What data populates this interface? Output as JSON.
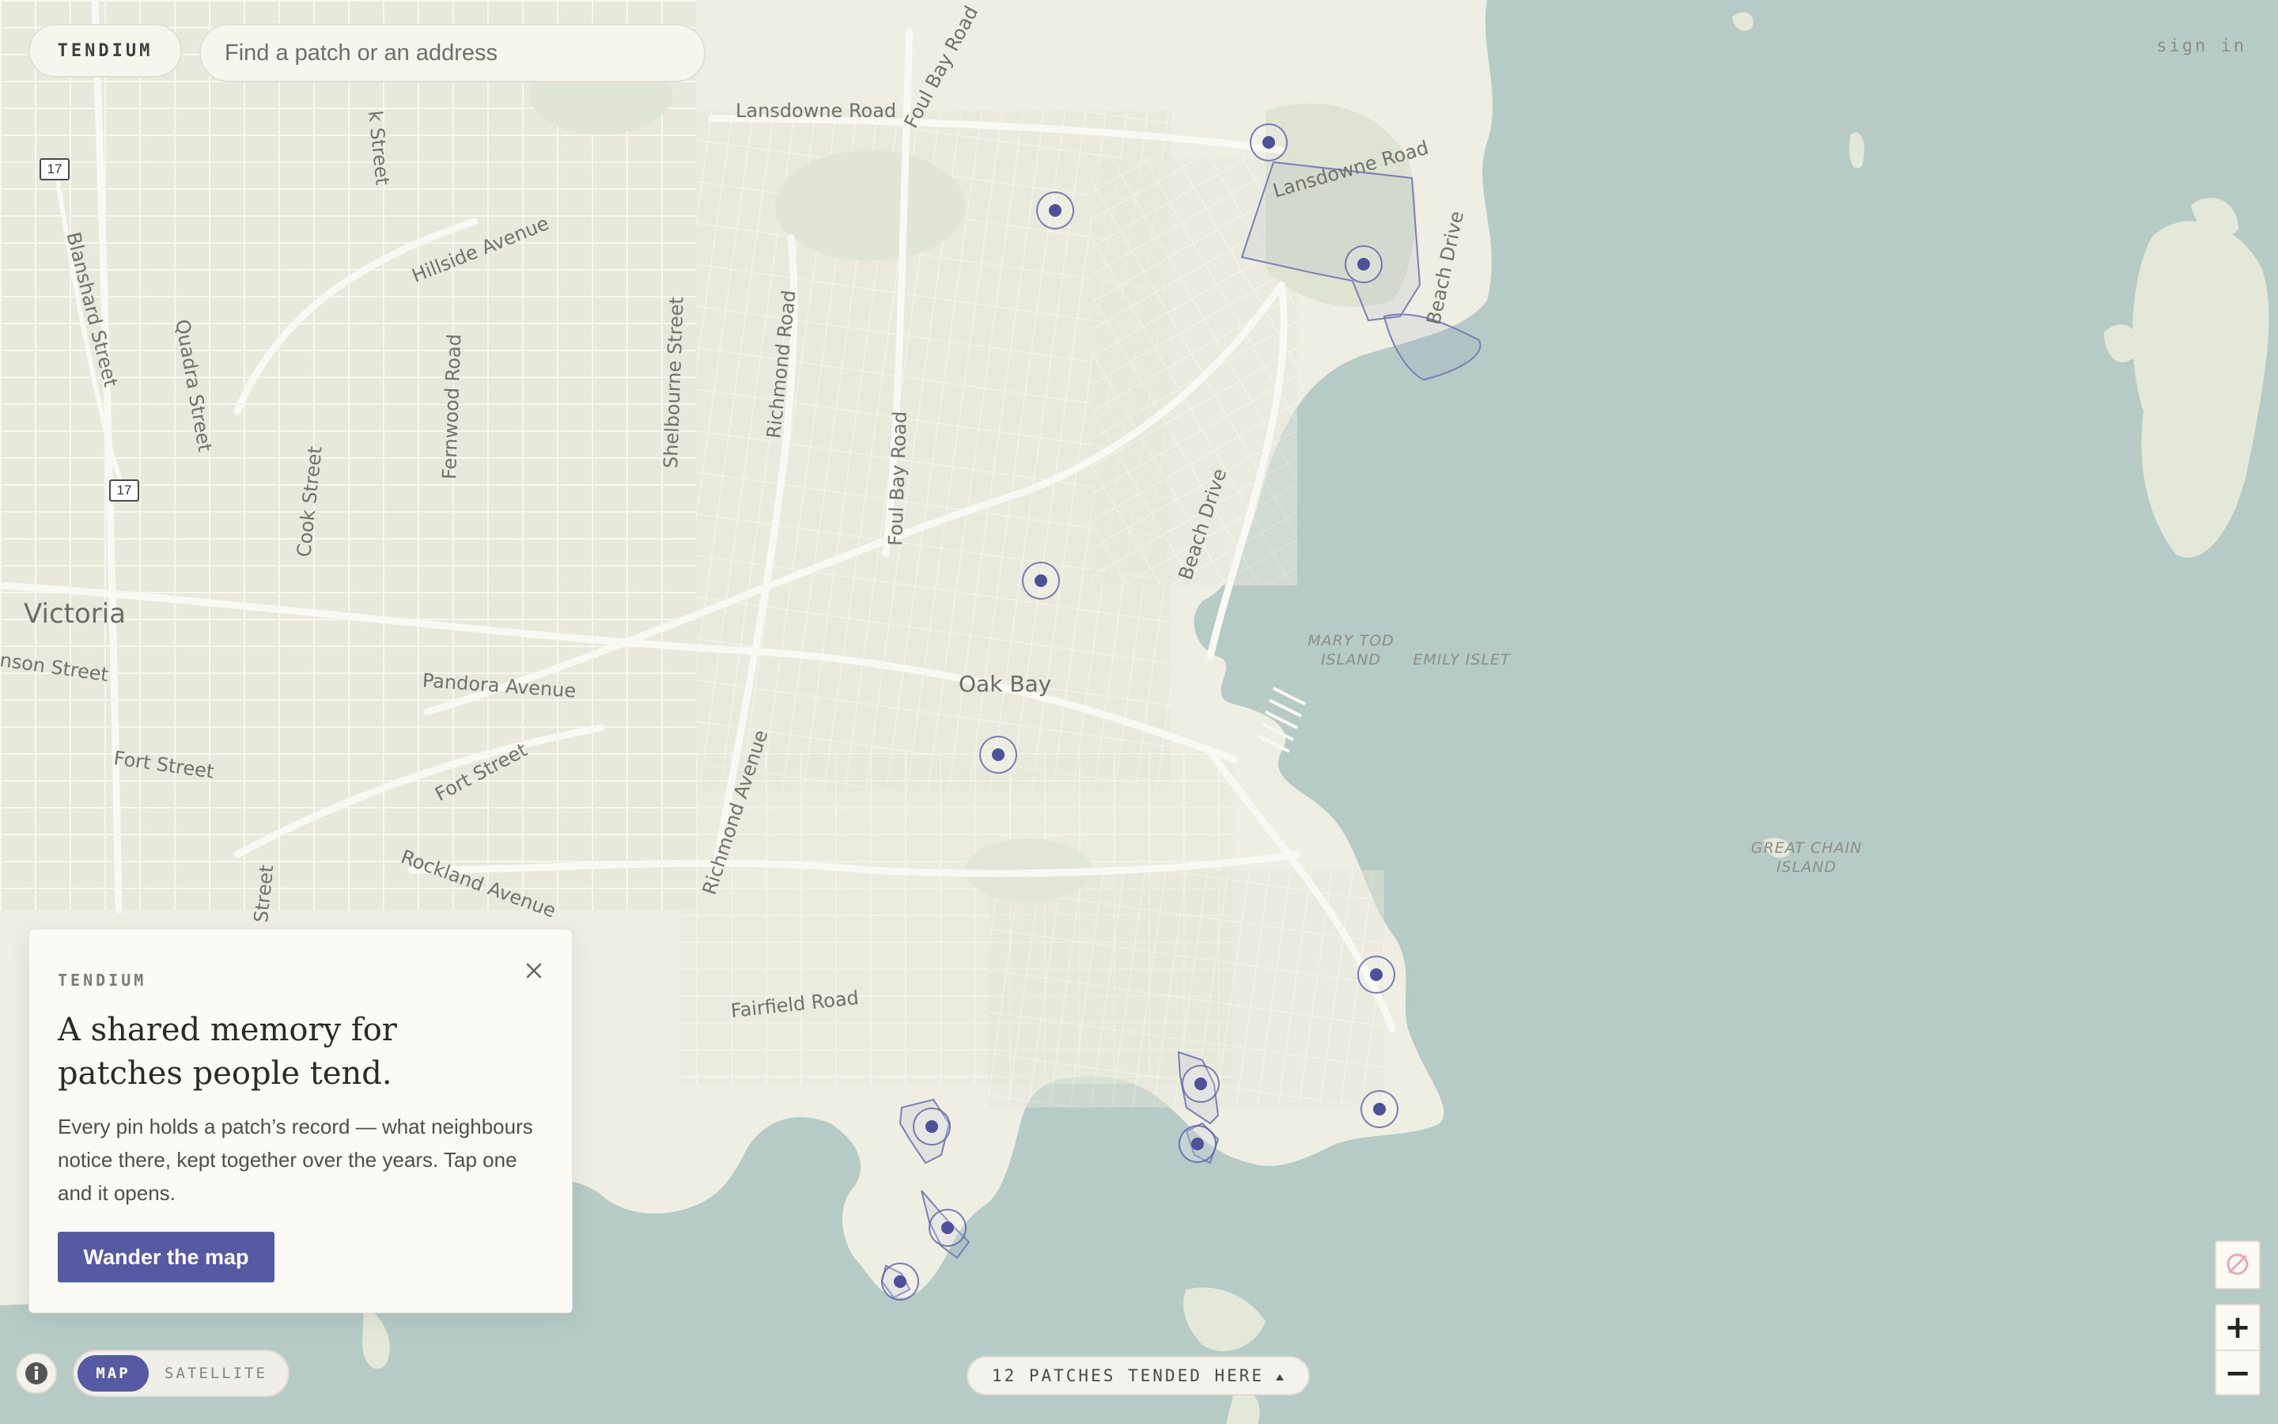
{
  "header": {
    "brand": "TENDIUM",
    "search_placeholder": "Find a patch or an address",
    "sign_in": "sign in"
  },
  "map": {
    "place_labels": [
      {
        "id": "victoria",
        "text": "Victoria"
      },
      {
        "id": "oak-bay",
        "text": "Oak Bay"
      }
    ],
    "island_labels": [
      {
        "id": "mary-tod",
        "line1": "MARY TOD",
        "line2": "ISLAND"
      },
      {
        "id": "emily-islet",
        "line1": "EMILY ISLET",
        "line2": ""
      },
      {
        "id": "great-chain",
        "line1": "GREAT CHAIN",
        "line2": "ISLAND"
      }
    ],
    "street_labels": [
      "Lansdowne Road",
      "Foul Bay Road",
      "Lansdowne Road",
      "Beach Drive",
      "Hillside Avenue",
      "Blanshard Street",
      "Quadra Street",
      "Fernwood Road",
      "Shelbourne Street",
      "Richmond Road",
      "Foul Bay Road",
      "Cook Street",
      "Beach Drive",
      "Pandora Avenue",
      "Fort Street",
      "Fort Street",
      "Rockland Avenue",
      "Richmond Avenue",
      "Fairfield Road",
      "nson Street",
      "k Street",
      "ok Street"
    ],
    "route_shields": [
      "17",
      "17"
    ],
    "pin_count": 12
  },
  "intro_card": {
    "eyebrow": "TENDIUM",
    "title": "A shared memory for patches people tend.",
    "body": "Every pin holds a patch’s record — what neighbours notice there, kept together over the years. Tap one and it opens.",
    "cta": "Wander the map"
  },
  "controls": {
    "map_mode": "MAP",
    "satellite_mode": "SATELLITE",
    "patch_count_text": "12 PATCHES TENDED HERE",
    "zoom_in": "+",
    "zoom_out": "−"
  },
  "colors": {
    "accent": "#565aa3",
    "land": "#eeeee2",
    "water": "#b7cbc6",
    "pin": "#4d509a"
  },
  "icons": [
    "info-icon",
    "close-icon",
    "layer-off-icon",
    "caret-up-icon"
  ]
}
